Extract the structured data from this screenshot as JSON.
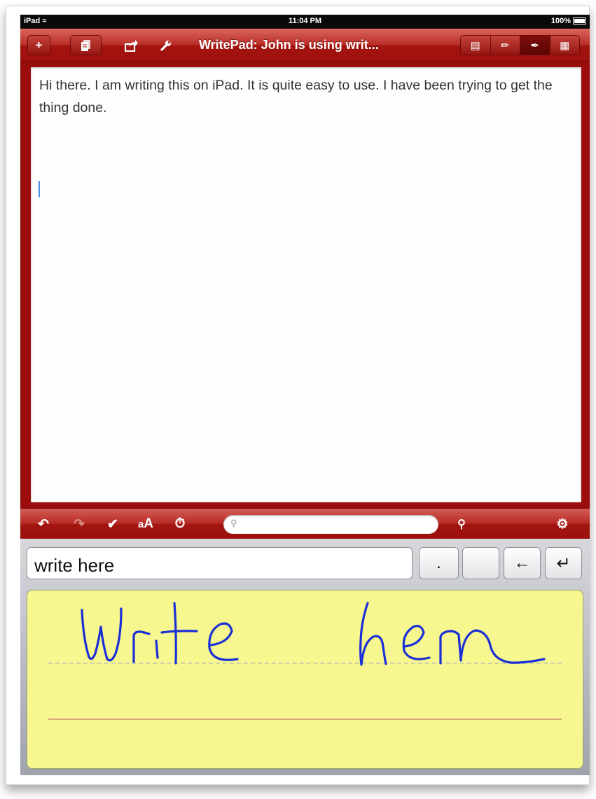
{
  "status_bar": {
    "device": "iPad",
    "time": "11:04 PM",
    "battery": "100%"
  },
  "top_toolbar": {
    "new_label": "+",
    "document_title": "WritePad: John is using writ...",
    "icons": [
      "plus-icon",
      "documents-icon",
      "share-icon",
      "wrench-icon",
      "page-icon",
      "pencil-icon",
      "pen-tip-icon",
      "keyboard-grid-icon"
    ]
  },
  "editor": {
    "text": "Hi there. I am writing this on iPad. It is quite easy to use. I have been trying to get the thing done."
  },
  "edit_toolbar": {
    "icons": [
      "undo-icon",
      "redo-icon",
      "check-icon",
      "font-size-icon",
      "timer-icon",
      "search-icon",
      "gear-icon"
    ],
    "search_placeholder": ""
  },
  "handwriting_input": {
    "recognized_text": "write here",
    "keys": [
      ".",
      "",
      "←",
      "↵"
    ],
    "ink_color": "#1b2fd6",
    "pad_color": "#f7f78f"
  }
}
